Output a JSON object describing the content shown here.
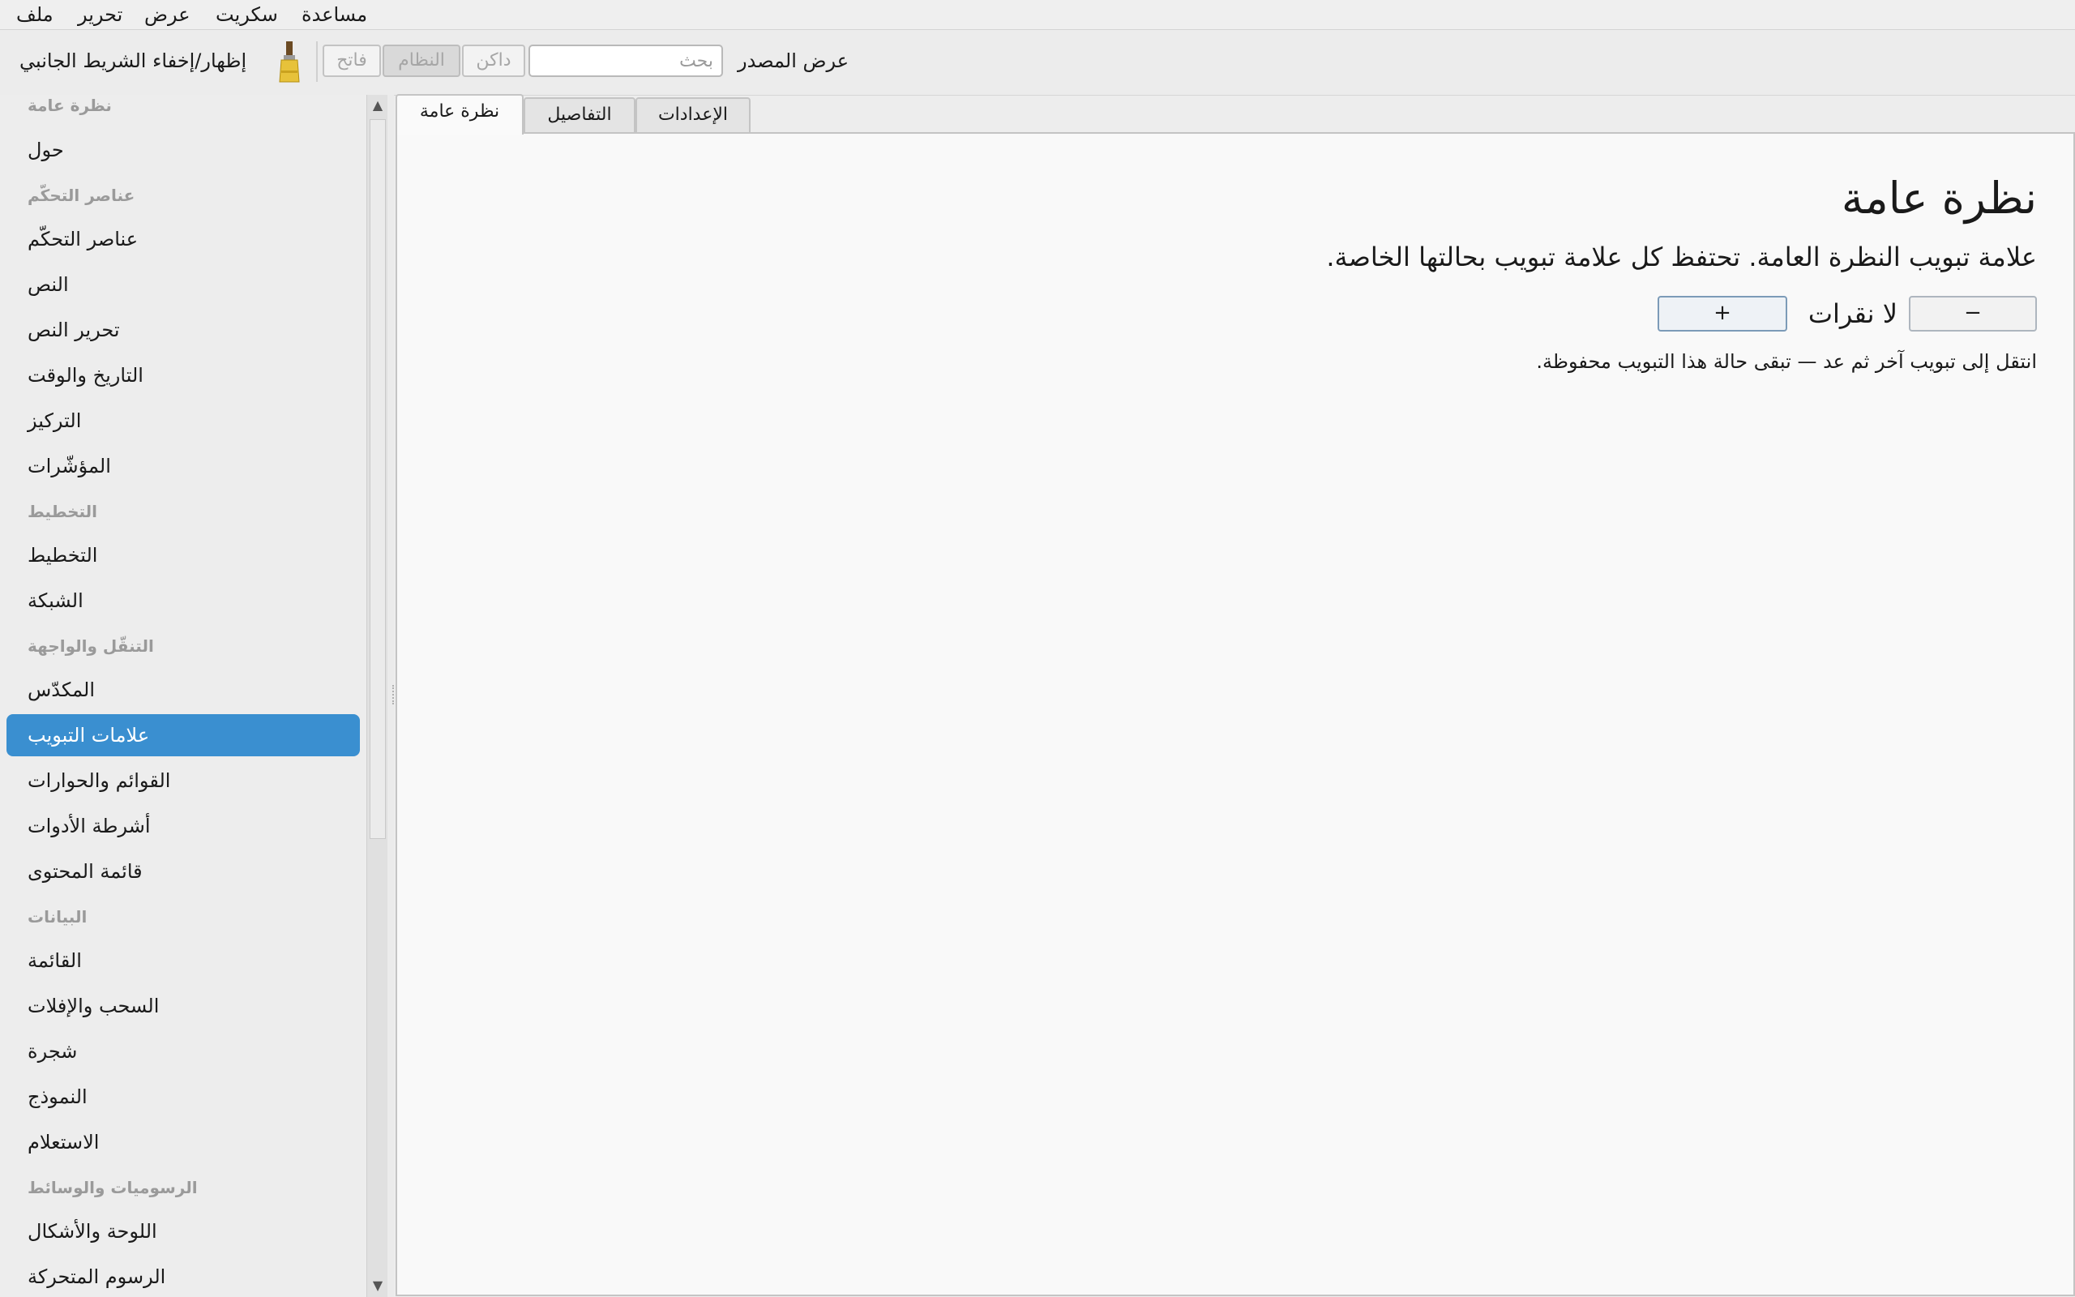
{
  "menubar": {
    "items": [
      "ملف",
      "تحرير",
      "عرض",
      "سكريت",
      "مساعدة"
    ]
  },
  "toolbar": {
    "toggle_sidebar": "إظهار/إخفاء الشريط الجانبي",
    "theme_light": "فاتح",
    "theme_system": "النظام",
    "theme_dark": "داكن",
    "search_placeholder": "بحث",
    "view_source": "عرض المصدر"
  },
  "sidebar": {
    "sections": [
      {
        "header": "نظرة عامة",
        "items": [
          "حول"
        ]
      },
      {
        "header": "عناصر التحكّم",
        "items": [
          "عناصر التحكّم",
          "النص",
          "تحرير النص",
          "التاريخ والوقت",
          "التركيز",
          "المؤشّرات"
        ]
      },
      {
        "header": "التخطيط",
        "items": [
          "التخطيط",
          "الشبكة"
        ]
      },
      {
        "header": "التنقّل والواجهة",
        "items": [
          "المكدّس",
          "علامات التبويب",
          "القوائم والحوارات",
          "أشرطة الأدوات",
          "قائمة المحتوى"
        ]
      },
      {
        "header": "البيانات",
        "items": [
          "القائمة",
          "السحب والإفلات",
          "شجرة",
          "النموذج",
          "الاستعلام"
        ]
      },
      {
        "header": "الرسوميات والوسائط",
        "items": [
          "اللوحة والأشكال",
          "الرسوم المتحركة"
        ]
      }
    ],
    "selected": "علامات التبويب"
  },
  "tabs": [
    "نظرة عامة",
    "التفاصيل",
    "الإعدادات"
  ],
  "active_tab": "نظرة عامة",
  "content": {
    "title": "نظرة عامة",
    "description": "علامة تبويب النظرة العامة. تحتفظ كل علامة تبويب بحالتها الخاصة.",
    "minus_label": "−",
    "plus_label": "+",
    "count_label": "لا نقرات",
    "hint": "انتقل إلى تبويب آخر ثم عد — تبقى حالة هذا التبويب محفوظة."
  },
  "colors": {
    "accent": "#3a8fd0",
    "section_header": "#9a9a9a"
  },
  "icons": {
    "theme": "paint-brush-icon"
  }
}
